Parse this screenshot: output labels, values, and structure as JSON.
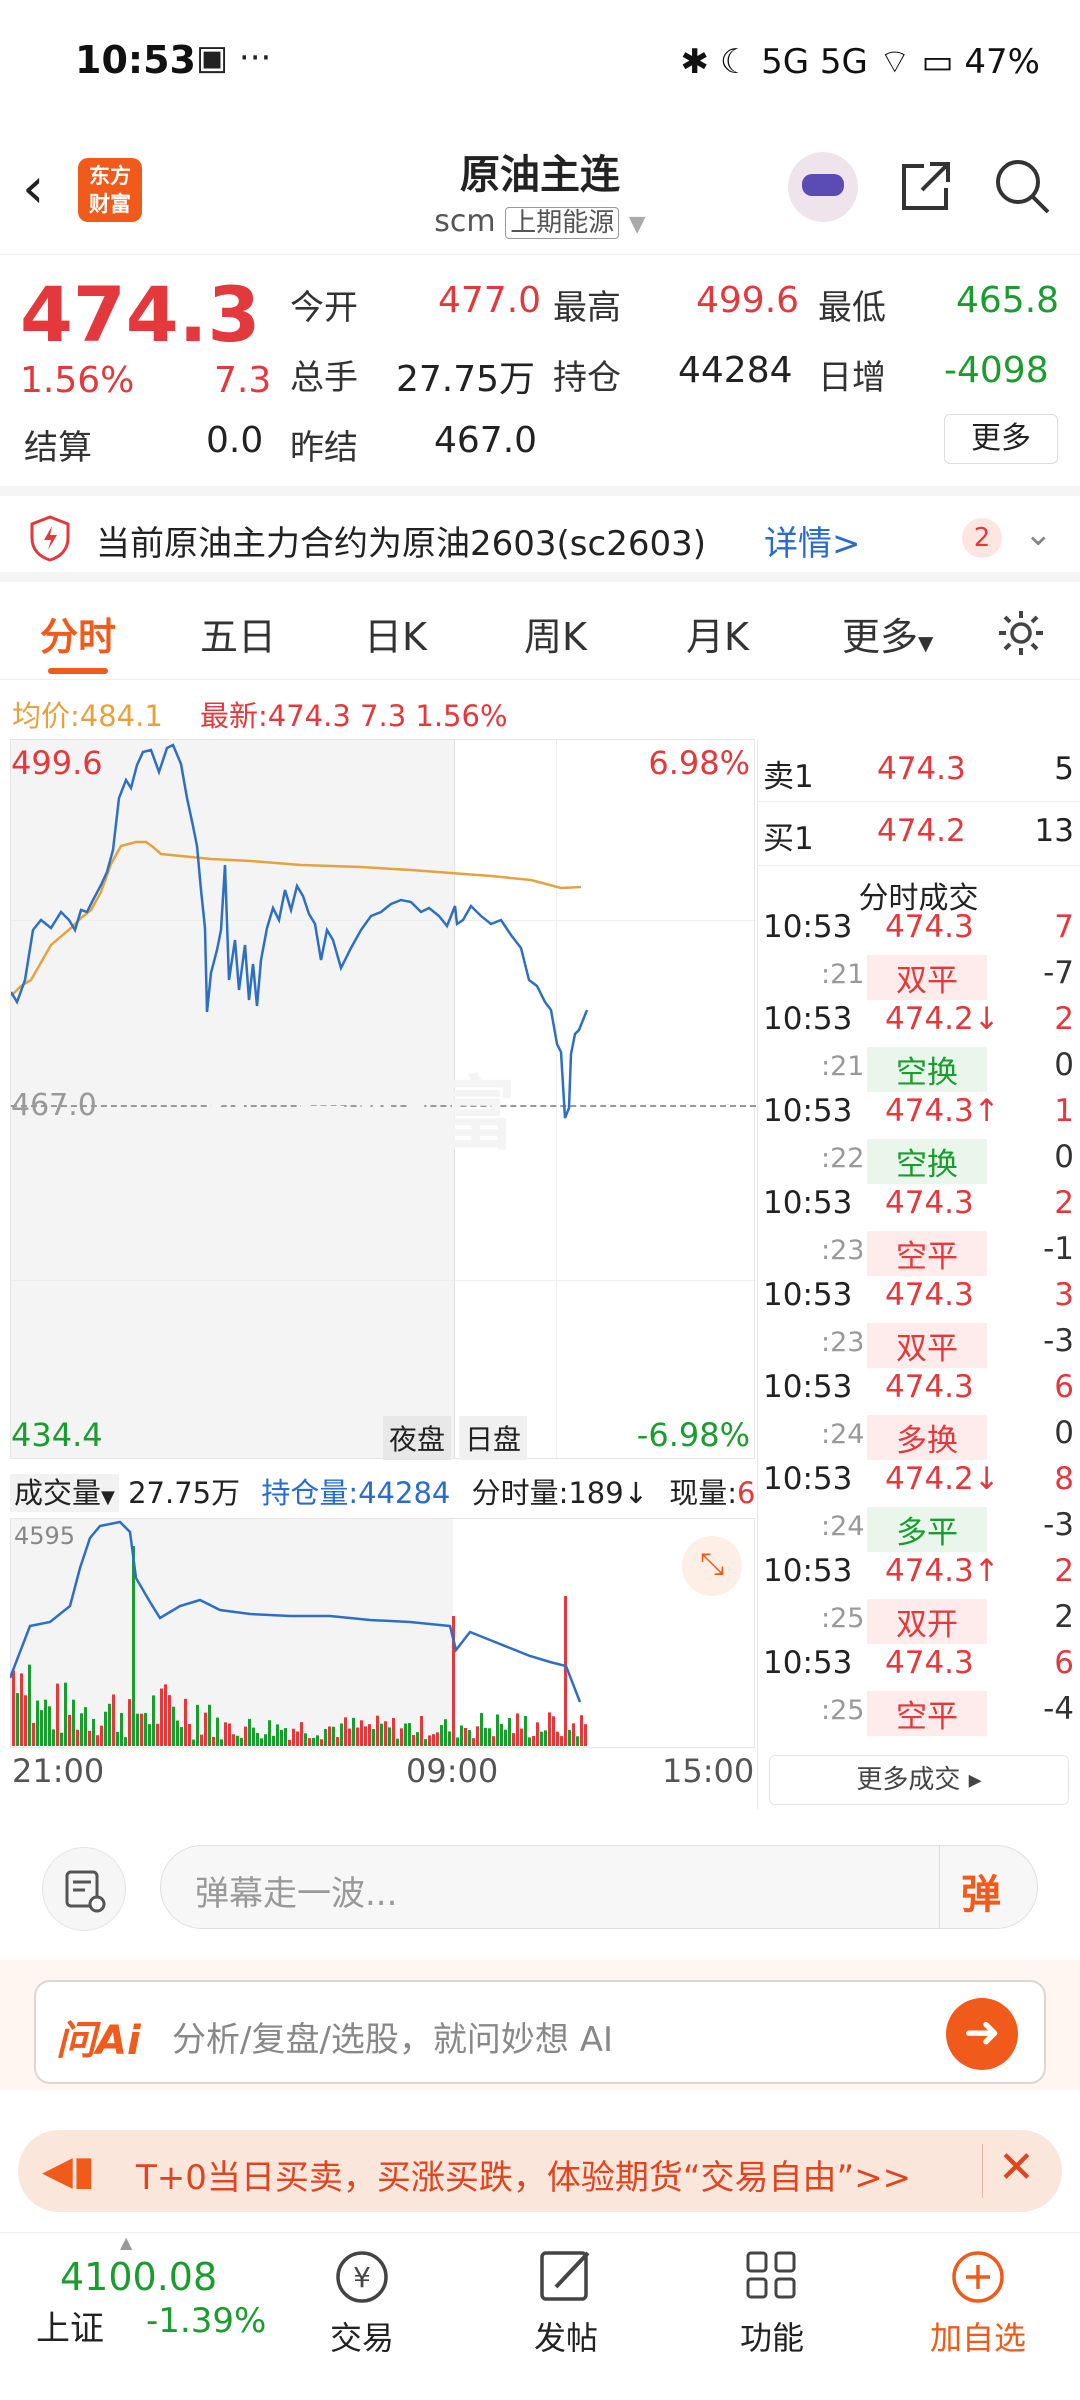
{
  "status": {
    "time": "10:53",
    "battery": "47%",
    "icons": "✱ ☾ 5G 5G ⌔ ▭"
  },
  "header": {
    "title": "原油主连",
    "code": "scm",
    "exchange": "上期能源",
    "logo": "东方\n财富"
  },
  "quote": {
    "price": "474.3",
    "pct": "1.56%",
    "chg": "7.3",
    "open_label": "今开",
    "open": "477.0",
    "high_label": "最高",
    "high": "499.6",
    "low_label": "最低",
    "low": "465.8",
    "vol_label": "总手",
    "vol": "27.75万",
    "oi_label": "持仓",
    "oi": "44284",
    "inc_label": "日增",
    "inc": "-4098",
    "settle_label": "结算",
    "settle": "0.0",
    "prev_label": "昨结",
    "prev": "467.0",
    "more": "更多"
  },
  "notice": {
    "text": "当前原油主力合约为原油2603(sc2603)",
    "link": "详情>",
    "badge": "2"
  },
  "tabs": [
    "分时",
    "五日",
    "日K",
    "周K",
    "月K",
    "更多"
  ],
  "info": {
    "avg_label": "均价:",
    "avg": "484.1",
    "last_label": "最新:",
    "last": "474.3",
    "chg": "7.3",
    "pct": "1.56%"
  },
  "chart": {
    "ymax": "499.6",
    "ymin": "434.4",
    "ref": "467.0",
    "pmax": "6.98%",
    "pmin": "-6.98%",
    "night": "夜盘",
    "day": "日盘",
    "watermark": "东方财富"
  },
  "vol": {
    "label": "成交量",
    "vol": "27.75万",
    "oi": "持仓量:44284",
    "tick": "分时量:189↓",
    "now_label": "现量:",
    "now": "6",
    "ymax": "4595",
    "x": [
      "21:00",
      "09:00",
      "15:00"
    ]
  },
  "book": {
    "ask_label": "卖1",
    "ask": "474.3",
    "ask_qty": "5",
    "bid_label": "买1",
    "bid": "474.2",
    "bid_qty": "13",
    "title": "分时成交",
    "more": "更多成交 ▸"
  },
  "trades": [
    {
      "t": "10:53",
      "p": "474.3",
      "q": "7",
      "s": ":21",
      "type": "双平",
      "n": "-7",
      "pc": "red",
      "tc": "red"
    },
    {
      "t": "10:53",
      "p": "474.2↓",
      "q": "2",
      "s": ":21",
      "type": "空换",
      "n": "0",
      "pc": "red",
      "tc": "green"
    },
    {
      "t": "10:53",
      "p": "474.3↑",
      "q": "1",
      "s": ":22",
      "type": "空换",
      "n": "0",
      "pc": "red",
      "tc": "green"
    },
    {
      "t": "10:53",
      "p": "474.3",
      "q": "2",
      "s": ":23",
      "type": "空平",
      "n": "-1",
      "pc": "red",
      "tc": "red"
    },
    {
      "t": "10:53",
      "p": "474.3",
      "q": "3",
      "s": ":23",
      "type": "双平",
      "n": "-3",
      "pc": "red",
      "tc": "red"
    },
    {
      "t": "10:53",
      "p": "474.3",
      "q": "6",
      "s": ":24",
      "type": "多换",
      "n": "0",
      "pc": "red",
      "tc": "red"
    },
    {
      "t": "10:53",
      "p": "474.2↓",
      "q": "8",
      "s": ":24",
      "type": "多平",
      "n": "-3",
      "pc": "red",
      "tc": "green"
    },
    {
      "t": "10:53",
      "p": "474.3↑",
      "q": "2",
      "s": ":25",
      "type": "双开",
      "n": "2",
      "pc": "red",
      "tc": "red"
    },
    {
      "t": "10:53",
      "p": "474.3",
      "q": "6",
      "s": ":25",
      "type": "空平",
      "n": "-4",
      "pc": "red",
      "tc": "red"
    }
  ],
  "danmaku": {
    "placeholder": "弹幕走一波...",
    "btn": "弹"
  },
  "ai": {
    "brand": "问Ai",
    "placeholder": "分析/复盘/选股，就问妙想 AI"
  },
  "promo": {
    "text": "T+0当日买卖，买涨买跌，体验期货“交易自由”>>"
  },
  "nav": {
    "index_value": "4100.08",
    "index_name": "上证",
    "index_pct": "-1.39%",
    "items": [
      "交易",
      "发帖",
      "功能",
      "加自选"
    ]
  }
}
